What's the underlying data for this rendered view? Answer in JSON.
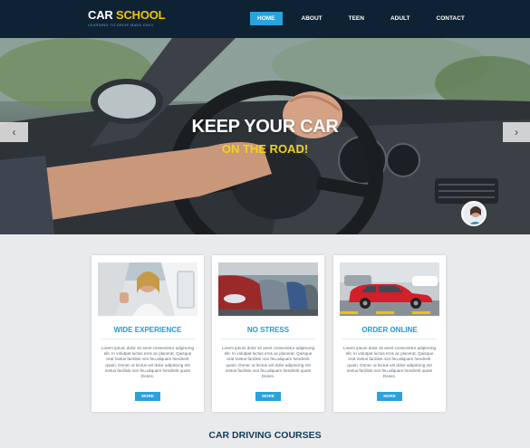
{
  "brand": {
    "name_part1": "CAR",
    "name_part2": "SCHOOL",
    "tagline": "LEARNING TO DRIVE MADE EASY"
  },
  "nav": {
    "items": [
      "HOME",
      "ABOUT",
      "TEEN",
      "ADULT",
      "CONTACT"
    ],
    "active": "HOME"
  },
  "hero": {
    "title": "KEEP YOUR CAR",
    "subtitle": "ON THE ROAD!",
    "prev_icon": "chevron-left-icon",
    "next_icon": "chevron-right-icon"
  },
  "cards": [
    {
      "title": "WIDE EXPERIENCE",
      "text": "Lorem ipsum dolor sit amet consectetur adipiscing elit. In volutpat luctus eros ac placerat. Quisque erat metus facilisis non feu,aliquam hendrerit quam. Donec ut lectus vel dolor adipiscing est metus facilisis non feu,aliquam hendrerit quam Donec.",
      "button": "MORE"
    },
    {
      "title": "NO STRESS",
      "text": "Lorem ipsum dolor sit amet consectetur adipiscing elit. In volutpat luctus eros ac placerat. Quisque erat metus facilisis non feu,aliquam hendrerit quam. Donec ut lectus vel dolor adipiscing est metus facilisis non feu,aliquam hendrerit quam Donec.",
      "button": "MORE"
    },
    {
      "title": "ORDER ONLINE",
      "text": "Lorem ipsum dolor sit amet consectetur adipiscing elit. In volutpat luctus eros ac placerat. Quisque erat metus facilisis non feu,aliquam hendrerit quam. Donec ut lectus vel dolor adipiscing est metus facilisis non feu,aliquam hendrerit quam Donec.",
      "button": "MORE"
    }
  ],
  "section": {
    "title": "CAR DRIVING COURSES"
  },
  "colors": {
    "header_bg": "#0e2233",
    "accent": "#2aa2dc",
    "brand_yellow": "#f4c400",
    "page_bg": "#e9eaec"
  }
}
